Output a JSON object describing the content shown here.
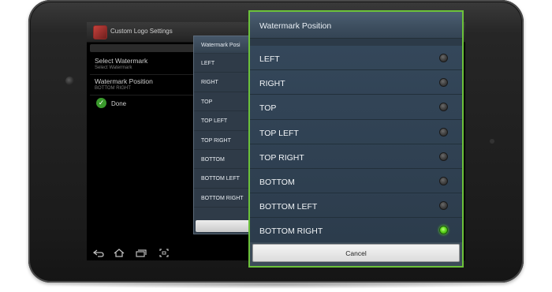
{
  "background_app": {
    "title": "Custom Logo Settings",
    "items": [
      {
        "title": "Select Watermark",
        "subtitle": "Select Watermark"
      },
      {
        "title": "Watermark Position",
        "subtitle": "BOTTOM RIGHT"
      }
    ],
    "done_label": "Done",
    "small_dialog_title": "Watermark Posi",
    "small_dialog_options": [
      "LEFT",
      "RIGHT",
      "TOP",
      "TOP LEFT",
      "TOP RIGHT",
      "BOTTOM",
      "BOTTOM LEFT",
      "BOTTOM RIGHT"
    ]
  },
  "dialog": {
    "title": "Watermark Position",
    "options": [
      {
        "label": "LEFT",
        "selected": false
      },
      {
        "label": "RIGHT",
        "selected": false
      },
      {
        "label": "TOP",
        "selected": false
      },
      {
        "label": "TOP LEFT",
        "selected": false
      },
      {
        "label": "TOP RIGHT",
        "selected": false
      },
      {
        "label": "BOTTOM",
        "selected": false
      },
      {
        "label": "BOTTOM LEFT",
        "selected": false
      },
      {
        "label": "BOTTOM RIGHT",
        "selected": true
      }
    ],
    "cancel_label": "Cancel"
  },
  "navigation": {
    "icons": [
      "back-icon",
      "home-icon",
      "recent-apps-icon",
      "screenshot-icon"
    ]
  },
  "colors": {
    "highlight_border": "#6cc23a",
    "selected_radio": "#5fd61e",
    "dialog_background": "#2c3a48"
  }
}
